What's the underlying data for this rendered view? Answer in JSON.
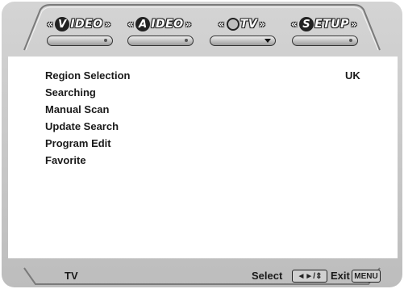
{
  "tabs": [
    {
      "letter": "V",
      "label": "IDEO",
      "indicator": "dot"
    },
    {
      "letter": "A",
      "label": "IDEO",
      "indicator": "dot"
    },
    {
      "letter": "",
      "label": "TV",
      "indicator": "triangle"
    },
    {
      "letter": "S",
      "label": "ETUP",
      "indicator": "dot"
    }
  ],
  "guillemet_left": "«",
  "guillemet_right": "»",
  "menu": {
    "items": [
      "Region Selection",
      "Searching",
      "Manual Scan",
      "Update Search",
      "Program Edit",
      "Favorite"
    ],
    "region_value": "UK"
  },
  "status": {
    "source": "TV",
    "select_label": "Select",
    "select_keys": "◄►/⇕",
    "exit_label": "Exit",
    "exit_key": "MENU"
  },
  "colors": {
    "bezel": "#c4c4c4",
    "panel": "#ffffff",
    "text": "#1a1a1a"
  }
}
